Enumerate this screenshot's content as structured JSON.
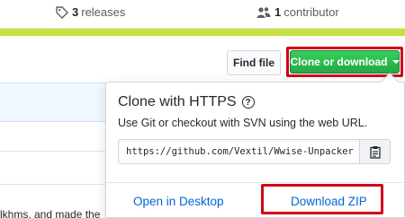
{
  "stats": {
    "releases_count": "3",
    "releases_label": "releases",
    "contributors_count": "1",
    "contributors_label": "contributor"
  },
  "toolbar": {
    "find_file_label": "Find file",
    "clone_label": "Clone or download"
  },
  "clone_popup": {
    "title": "Clone with HTTPS",
    "help_symbol": "?",
    "description": "Use Git or checkout with SVN using the web URL.",
    "url": "https://github.com/Vextil/Wwise-Unpacker",
    "open_desktop_label": "Open in Desktop",
    "download_zip_label": "Download ZIP"
  },
  "background": {
    "commit_fragment": "lkhms, and made the"
  },
  "colors": {
    "accent_green": "#28a745",
    "highlight_red": "#d0021b",
    "link_blue": "#0366d6",
    "language_bar": "#c6e03f"
  },
  "icons": {
    "releases": "tag-icon",
    "contributors": "people-icon",
    "copy": "clipboard-icon",
    "dropdown": "caret-down-icon",
    "help": "question-icon"
  }
}
